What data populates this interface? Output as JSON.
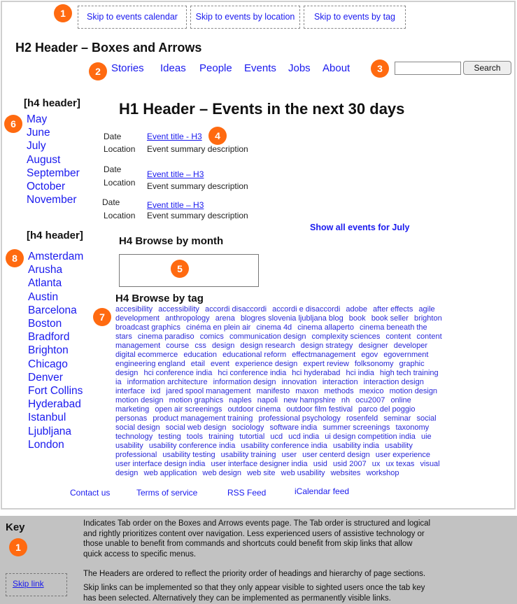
{
  "skip_links": [
    "Skip to events calendar",
    "Skip to events by location",
    "Skip to events by tag"
  ],
  "badges": [
    "1",
    "2",
    "3",
    "4",
    "5",
    "6",
    "7",
    "8"
  ],
  "site_header": "H2 Header – Boxes and Arrows",
  "nav": [
    "Stories",
    "Ideas",
    "People",
    "Events",
    "Jobs",
    "About"
  ],
  "search": {
    "value": "",
    "button_label": "Search"
  },
  "sidebar": {
    "months_header": "[h4 header]",
    "months": [
      "May",
      "June",
      "July",
      "August",
      "September",
      "October",
      "November"
    ],
    "cities_header": "[h4 header]",
    "cities": [
      "Amsterdam",
      "Arusha",
      "Atlanta",
      "Austin",
      "Barcelona",
      "Boston",
      "Bradford",
      "Brighton",
      "Chicago",
      "Denver",
      "Fort Collins",
      "Hyderabad",
      "Istanbul",
      "Ljubljana",
      "London"
    ]
  },
  "main": {
    "title": "H1 Header – Events in the next 30 days",
    "events": [
      {
        "date_label": "Date",
        "location_label": "Location",
        "title": "Event title - H3",
        "summary": "Event summary description"
      },
      {
        "date_label": "Date",
        "location_label": "Location",
        "title": "Event title – H3",
        "summary": "Event summary description"
      },
      {
        "date_label": "Date",
        "location_label": "Location",
        "title": "Event title – H3",
        "summary": "Event summary description"
      }
    ],
    "show_all": "Show all events for July",
    "browse_month_header": "H4 Browse by month",
    "browse_tag_header": "H4 Browse by tag",
    "tags": [
      "accesibility",
      "accessibility",
      "accordi disaccordi",
      "accordi e disaccordi",
      "adobe",
      "after effects",
      "agile development",
      "anthropology",
      "arena",
      "blogres slovenia ljubljana blog",
      "book",
      "book seller",
      "brighton broadcast graphics",
      "cinéma en plein air",
      "cinema 4d",
      "cinema allaperto",
      "cinema beneath the stars",
      "cinema paradiso",
      "comics",
      "communication design",
      "complexity sciences",
      "content",
      "content management",
      "course",
      "css",
      "design",
      "design research",
      "design strategy",
      "designer",
      "developer",
      "digital ecommerce",
      "education",
      "educational reform",
      "effectmanagement",
      "egov",
      "egovernment",
      "engineering england",
      "etail",
      "event",
      "experience design",
      "expert review",
      "folksonomy",
      "graphic design",
      "hci conference india",
      "hci conference india",
      "hci hyderabad",
      "hci india",
      "high tech training",
      "ia",
      "information architecture",
      "information design",
      "innovation",
      "interaction",
      "interaction design",
      "interface",
      "ixd",
      "jared spool management",
      "manifesto",
      "maxon",
      "methods",
      "mexico",
      "motion design",
      "motion design",
      "motion graphics",
      "naples",
      "napoli",
      "new hampshire",
      "nh",
      "ocu2007",
      "online marketing",
      "open air screenings",
      "outdoor cinema",
      "outdoor film festival",
      "parco del poggio",
      "personas",
      "product management training",
      "professional psychology",
      "rosenfeld",
      "seminar",
      "social",
      "social design",
      "social web design",
      "sociology",
      "software india",
      "summer screenings",
      "taxonomy",
      "technology",
      "testing",
      "tools",
      "training",
      "tutortial",
      "ucd",
      "ucd india",
      "ui design competition india",
      "uie",
      "usability",
      "usability conference india",
      "usability conference india",
      "usability india",
      "usability professional",
      "usability testing",
      "usability training",
      "user",
      "user centerd design",
      "user experience",
      "user interface design india",
      "user interface designer india",
      "usid",
      "usid 2007",
      "ux",
      "ux texas",
      "visual design",
      "web application",
      "web design",
      "web site",
      "web usability",
      "websites",
      "workshop"
    ]
  },
  "footer": [
    "Contact us",
    "Terms of service",
    "RSS Feed",
    "iCalendar feed"
  ],
  "key": {
    "title": "Key",
    "badge": "1",
    "tab_order_text": "Indicates Tab order on the Boxes and Arrows events page. The Tab order is structured and logical and rightly prioritizes content over navigation. Less experienced users of assistive technology or those unable to benefit from commands and shortcuts could benefit from skip links that allow quick access to specific menus.",
    "headers_text": "The Headers are ordered to reflect the priority order of headings and hierarchy of page sections.",
    "skip_link_label": "Skip link",
    "skip_link_text": "Skip links can be implemented so that they only appear visible to sighted users once the tab key has been selected.  Alternatively they can be implemented as permanently visible links."
  },
  "colors": {
    "badge": "#ff6a10",
    "link": "#1a1aee",
    "key_bg": "#c2c2c2"
  }
}
